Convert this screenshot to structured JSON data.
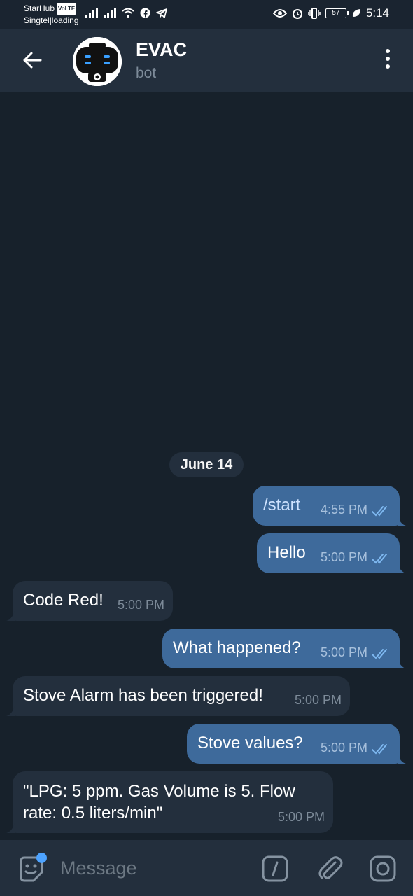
{
  "status_bar": {
    "carrier1": "StarHub",
    "volte": "VoLTE",
    "carrier2": "Singtel|loading",
    "battery": "57",
    "time": "5:14"
  },
  "header": {
    "title": "EVAC",
    "subtitle": "bot"
  },
  "chat": {
    "date": "June 14",
    "messages": [
      {
        "dir": "out",
        "text": "/start",
        "time": "4:55 PM"
      },
      {
        "dir": "out",
        "text": "Hello",
        "time": "5:00 PM"
      },
      {
        "dir": "in",
        "text": "Code Red!",
        "time": "5:00 PM"
      },
      {
        "dir": "out",
        "text": "What happened?",
        "time": "5:00 PM"
      },
      {
        "dir": "in",
        "text": "Stove Alarm has been triggered!",
        "time": "5:00 PM"
      },
      {
        "dir": "out",
        "text": "Stove values?",
        "time": "5:00 PM"
      },
      {
        "dir": "in",
        "text": "\"LPG: 5 ppm. Gas Volume is 5.  Flow rate: 0.5 liters/min\"",
        "time": "5:00 PM"
      }
    ]
  },
  "input": {
    "placeholder": "Message"
  },
  "colors": {
    "background": "#17212b",
    "header": "#232f3d",
    "outgoing_bubble": "#3e6a9b",
    "incoming_bubble": "#232f3d",
    "accent": "#4da3ff"
  }
}
